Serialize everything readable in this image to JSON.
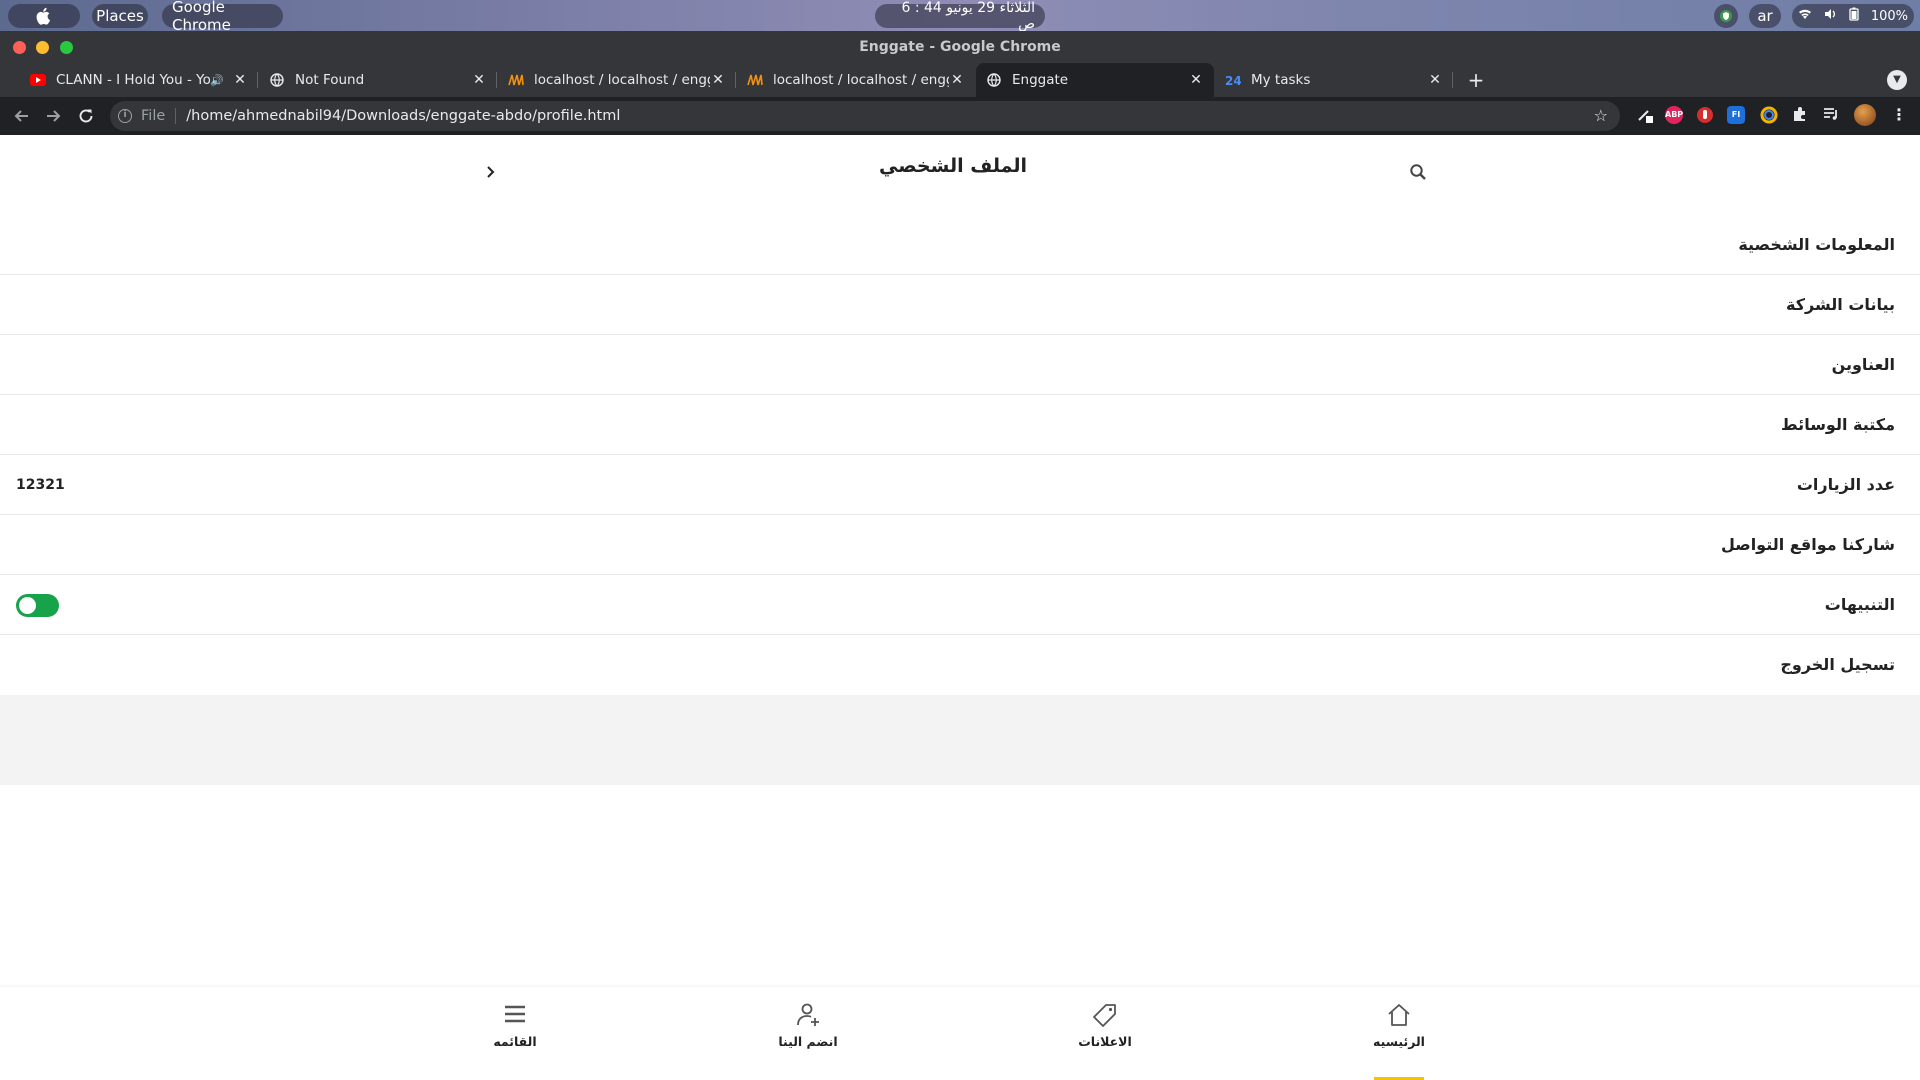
{
  "os": {
    "places": "Places",
    "app": "Google Chrome",
    "clock": "الثلاثاء 29 يونيو   44 : 6 ص",
    "language": "ar",
    "battery": "100%"
  },
  "window": {
    "title": "Enggate - Google Chrome"
  },
  "tabs": [
    {
      "title": "CLANN - I Hold You - YouTube",
      "favicon": "youtube-icon"
    },
    {
      "title": "Not Found",
      "favicon": "globe-icon"
    },
    {
      "title": "localhost / localhost / enggate",
      "favicon": "phpmyadmin-icon"
    },
    {
      "title": "localhost / localhost / enggate",
      "favicon": "phpmyadmin-icon"
    },
    {
      "title": "Enggate",
      "favicon": "globe-icon"
    },
    {
      "title": "My tasks",
      "favicon": "tasks-icon"
    }
  ],
  "omnibox": {
    "scheme_label": "File",
    "url": "/home/ahmednabil94/Downloads/enggate-abdo/profile.html"
  },
  "page": {
    "title": "الملف الشخصي"
  },
  "settings": [
    {
      "label": "المعلومات الشخصية"
    },
    {
      "label": "بيانات الشركة"
    },
    {
      "label": "العناوين"
    },
    {
      "label": "مكتبة الوسائط"
    },
    {
      "label": "عدد الزيارات",
      "value": "12321"
    },
    {
      "label": "شاركنا مواقع التواصل"
    },
    {
      "label": "التنبيهات",
      "toggle": true
    },
    {
      "label": "تسجيل الخروج"
    }
  ],
  "bottom_nav": {
    "home": "الرئيسيه",
    "ads": "الاعلانات",
    "join": "انضم الينا",
    "menu": "القائمه"
  },
  "colors": {
    "toggle_on": "#16a34a",
    "active_underline": "#f5c400"
  }
}
